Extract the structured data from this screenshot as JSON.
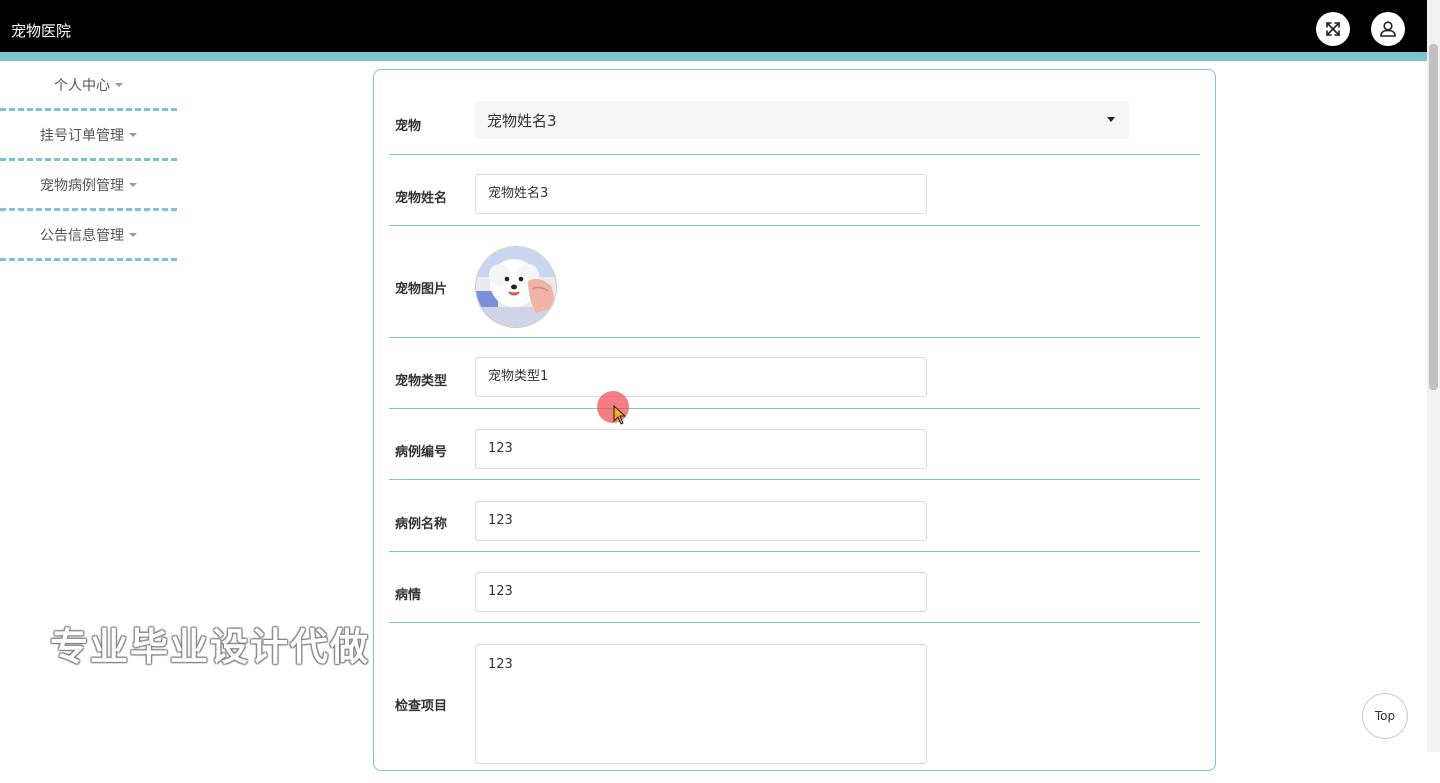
{
  "header": {
    "app_title": "宠物医院",
    "fullscreen_icon": "fullscreen-icon",
    "user_icon": "user-icon",
    "bg_color": "#000000",
    "accent_color": "#7ac5cf"
  },
  "sidebar": {
    "items": [
      {
        "label": "个人中心"
      },
      {
        "label": "挂号订单管理"
      },
      {
        "label": "宠物病例管理"
      },
      {
        "label": "公告信息管理"
      }
    ]
  },
  "form": {
    "pet_label": "宠物",
    "pet_selected": "宠物姓名3",
    "pet_name_label": "宠物姓名",
    "pet_name_value": "宠物姓名3",
    "pet_photo_label": "宠物图片",
    "pet_type_label": "宠物类型",
    "pet_type_value": "宠物类型1",
    "case_no_label": "病例编号",
    "case_no_value": "123",
    "case_name_label": "病例名称",
    "case_name_value": "123",
    "condition_label": "病情",
    "condition_value": "123",
    "exam_label": "检查项目",
    "exam_value": "123"
  },
  "watermark": "专业毕业设计代做",
  "back_to_top": "Top"
}
